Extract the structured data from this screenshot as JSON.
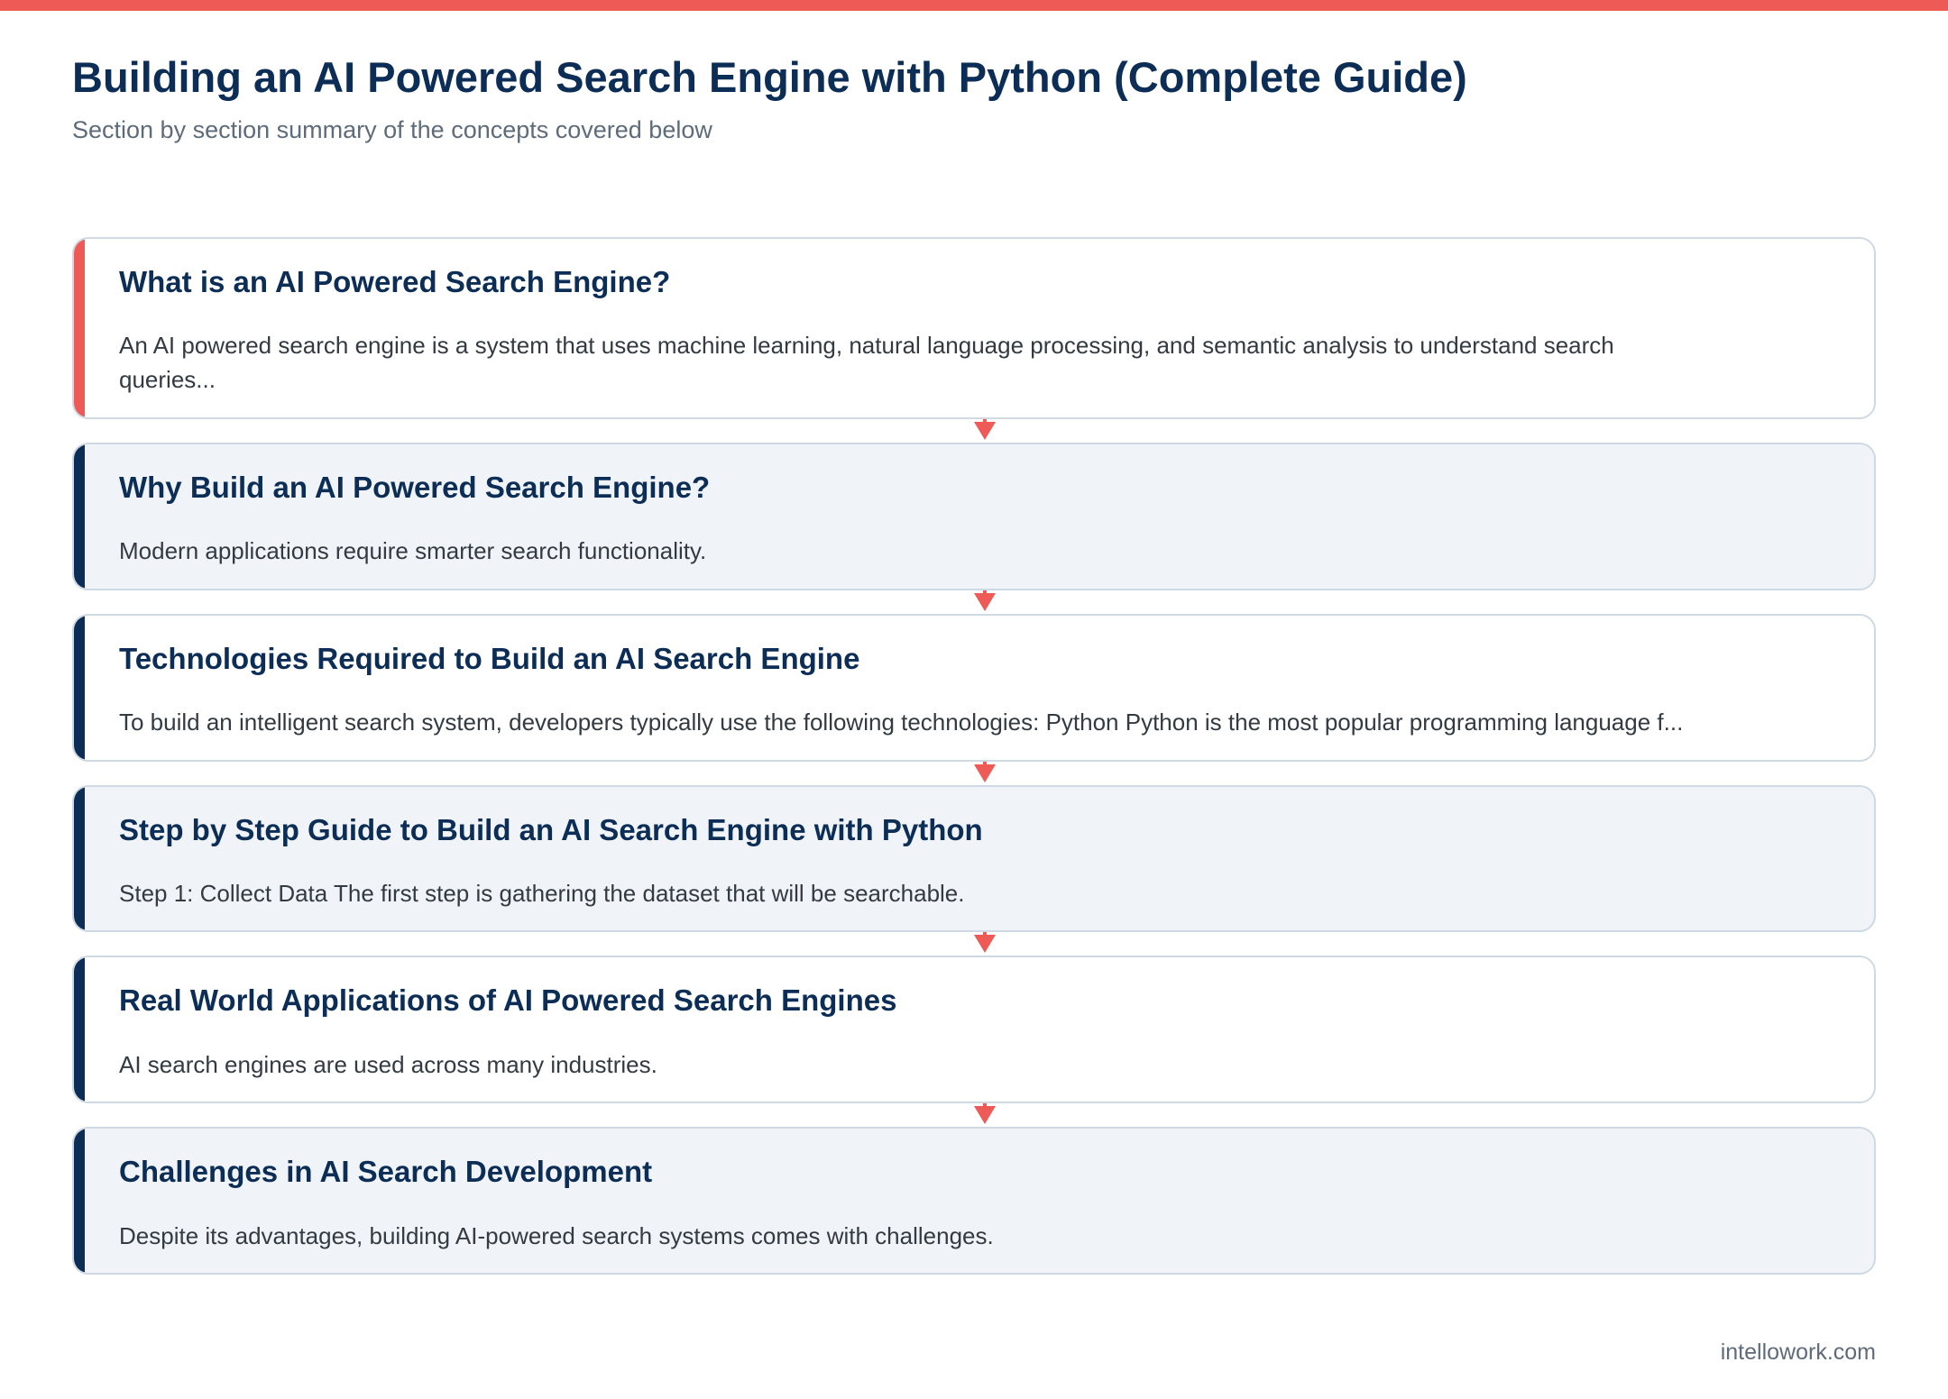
{
  "header": {
    "title": "Building an AI Powered Search Engine with Python (Complete Guide)",
    "subtitle": "Section by section summary of the concepts covered below"
  },
  "sections": [
    {
      "title": "What is an AI Powered Search Engine?",
      "text": "An AI powered search engine is a system that uses machine learning, natural language processing, and semantic analysis to understand search queries..."
    },
    {
      "title": "Why Build an AI Powered Search Engine?",
      "text": "Modern applications require smarter search functionality."
    },
    {
      "title": "Technologies Required to Build an AI Search Engine",
      "text": "To build an intelligent search system, developers typically use the following technologies: Python Python is the most popular programming language f..."
    },
    {
      "title": "Step by Step Guide to Build an AI Search Engine with Python",
      "text": "Step 1: Collect Data The first step is gathering the dataset that will be searchable."
    },
    {
      "title": "Real World Applications of AI Powered Search Engines",
      "text": "AI search engines are used across many industries."
    },
    {
      "title": "Challenges in AI Search Development",
      "text": "Despite its advantages, building AI-powered search systems comes with challenges."
    }
  ],
  "footer": {
    "site": "intellowork.com"
  },
  "colors": {
    "accent": "#ee5a55",
    "navy": "#0c2d55",
    "alt_card_bg": "#f0f4f8",
    "border": "#cfd9e3"
  }
}
